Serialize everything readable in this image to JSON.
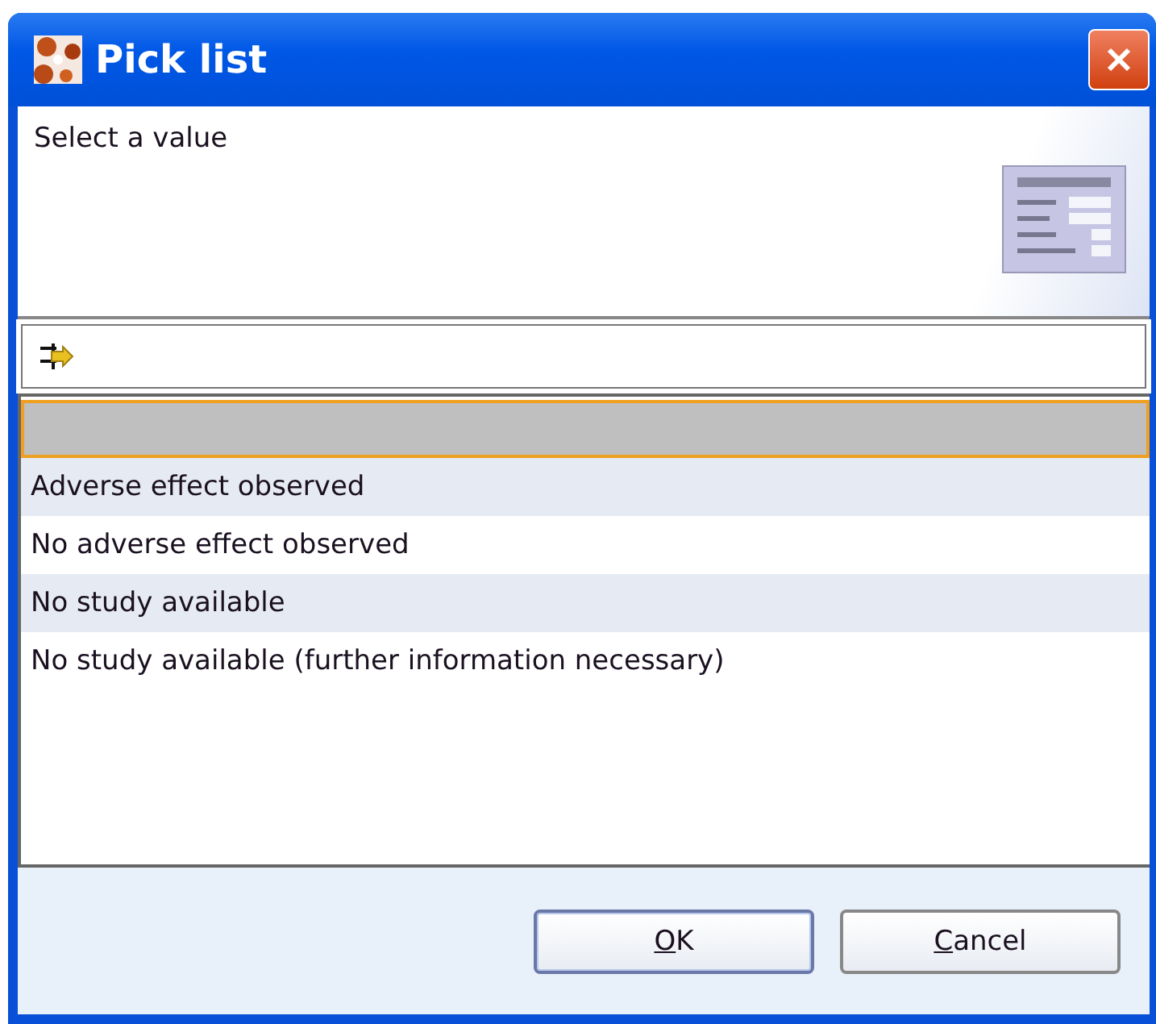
{
  "window": {
    "title": "Pick list"
  },
  "header": {
    "message": "Select a value"
  },
  "list": {
    "items": [
      {
        "selected": true
      },
      {
        "label": "Adverse effect observed",
        "selected": false
      },
      {
        "label": "No adverse effect observed",
        "selected": false
      },
      {
        "label": "No study available",
        "selected": false
      },
      {
        "label": "No study available (further information necessary)",
        "selected": false
      }
    ]
  },
  "buttons": [
    {
      "mnemonic": "O",
      "rest": "K",
      "default": true
    },
    {
      "mnemonic": "C",
      "rest": "ancel",
      "default": false
    }
  ]
}
